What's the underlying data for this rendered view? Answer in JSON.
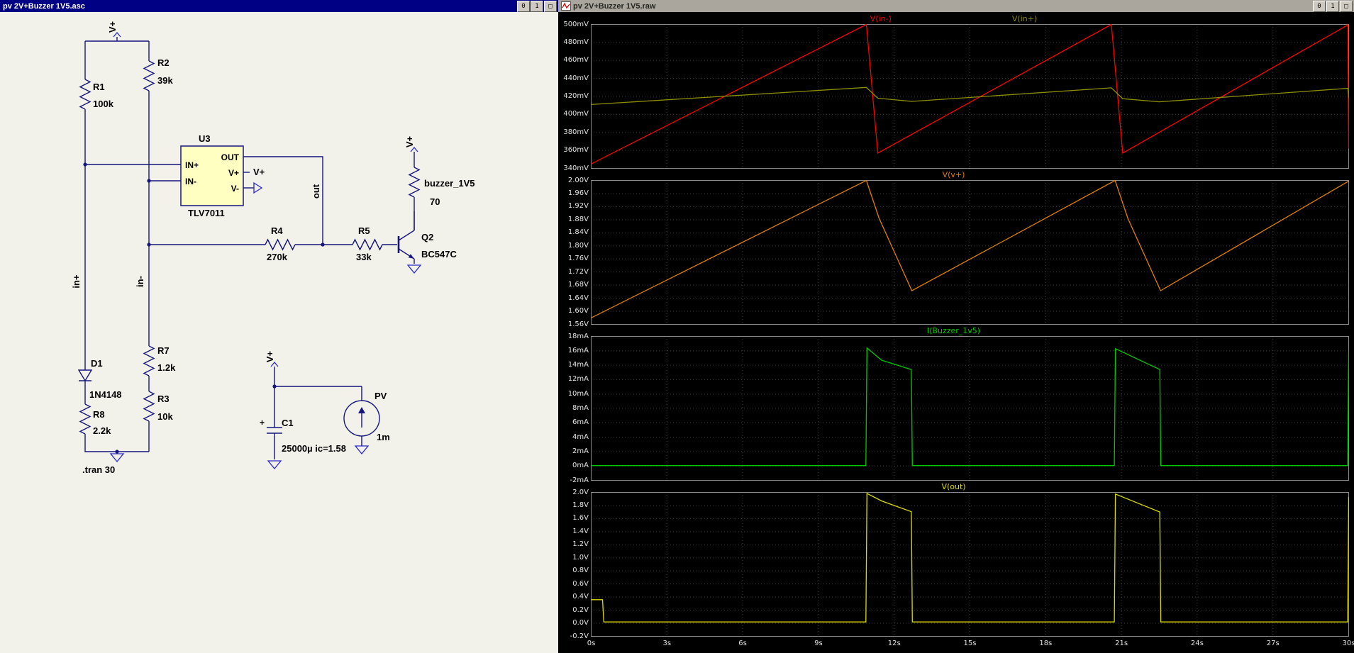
{
  "left_window": {
    "title": "pv 2V+Buzzer 1V5.asc",
    "window_buttons": [
      "0",
      "1",
      "□"
    ],
    "schematic": {
      "net_vplus": "V+",
      "net_in_plus": "in+",
      "net_in_minus": "in-",
      "net_out": "out",
      "r1": {
        "name": "R1",
        "value": "100k"
      },
      "r2": {
        "name": "R2",
        "value": "39k"
      },
      "r3": {
        "name": "R3",
        "value": "10k"
      },
      "r4": {
        "name": "R4",
        "value": "270k"
      },
      "r5": {
        "name": "R5",
        "value": "33k"
      },
      "r7": {
        "name": "R7",
        "value": "1.2k"
      },
      "r8": {
        "name": "R8",
        "value": "2.2k"
      },
      "buzzer": {
        "name": "buzzer_1V5",
        "value": "70"
      },
      "u3": {
        "name": "U3",
        "part": "TLV7011",
        "pin_in_plus": "IN+",
        "pin_in_minus": "IN-",
        "pin_out": "OUT",
        "pin_vplus": "V+",
        "pin_vminus": "V-"
      },
      "q2": {
        "name": "Q2",
        "part": "BC547C"
      },
      "d1": {
        "name": "D1",
        "part": "1N4148"
      },
      "c1": {
        "name": "C1",
        "value": "25000µ ic=1.58",
        "polarity": "+"
      },
      "pv": {
        "name": "PV",
        "value": "1m"
      },
      "directive": ".tran 30"
    }
  },
  "right_window": {
    "title": "pv 2V+Buzzer 1V5.raw",
    "window_buttons": [
      "0",
      "1",
      "□"
    ]
  },
  "time_axis": {
    "values": [
      0,
      3,
      6,
      9,
      12,
      15,
      18,
      21,
      24,
      27,
      30
    ],
    "labels": [
      "0s",
      "3s",
      "6s",
      "9s",
      "12s",
      "15s",
      "18s",
      "21s",
      "24s",
      "27s",
      "30s"
    ]
  },
  "chart_data": [
    {
      "type": "line",
      "xlim": [
        0,
        30
      ],
      "ylim": [
        0.34,
        0.5
      ],
      "titles": [
        {
          "text": "V(in-)",
          "color": "#ff0000"
        },
        {
          "text": "V(in+)",
          "color": "#8e8e00"
        }
      ],
      "ytick_values": [
        0.5,
        0.48,
        0.46,
        0.44,
        0.42,
        0.4,
        0.38,
        0.36,
        0.34
      ],
      "ytick_labels": [
        "500mV",
        "480mV",
        "460mV",
        "440mV",
        "420mV",
        "400mV",
        "380mV",
        "360mV",
        "340mV"
      ],
      "series": [
        {
          "name": "V(in-)",
          "color": "#ff0000",
          "points": [
            [
              0,
              0.345
            ],
            [
              10.9,
              0.5
            ],
            [
              11.35,
              0.357
            ],
            [
              20.6,
              0.5
            ],
            [
              21.05,
              0.357
            ],
            [
              29.97,
              0.4995
            ],
            [
              30,
              0.362
            ]
          ]
        },
        {
          "name": "V(in+)",
          "color": "#8e8e00",
          "points": [
            [
              0,
              0.411
            ],
            [
              10.9,
              0.43
            ],
            [
              11.35,
              0.418
            ],
            [
              12.7,
              0.4145
            ],
            [
              20.6,
              0.4295
            ],
            [
              21.05,
              0.4175
            ],
            [
              22.5,
              0.414
            ],
            [
              29.97,
              0.429
            ],
            [
              30,
              0.4185
            ]
          ]
        }
      ]
    },
    {
      "type": "line",
      "xlim": [
        0,
        30
      ],
      "ylim": [
        1.56,
        2.0
      ],
      "titles": [
        {
          "text": "V(v+)",
          "color": "#e08000"
        }
      ],
      "ytick_values": [
        2.0,
        1.96,
        1.92,
        1.88,
        1.84,
        1.8,
        1.76,
        1.72,
        1.68,
        1.64,
        1.6,
        1.56
      ],
      "ytick_labels": [
        "2.00V",
        "1.96V",
        "1.92V",
        "1.88V",
        "1.84V",
        "1.80V",
        "1.76V",
        "1.72V",
        "1.68V",
        "1.64V",
        "1.60V",
        "1.56V"
      ],
      "series": [
        {
          "name": "V(v+)",
          "color": "#e08000",
          "points": [
            [
              0,
              1.58
            ],
            [
              10.9,
              2.0
            ],
            [
              11.4,
              1.885
            ],
            [
              12.7,
              1.663
            ],
            [
              20.75,
              2.0
            ],
            [
              21.25,
              1.885
            ],
            [
              22.55,
              1.663
            ],
            [
              30,
              1.998
            ]
          ]
        }
      ]
    },
    {
      "type": "line",
      "xlim": [
        0,
        30
      ],
      "ylim": [
        -2,
        18
      ],
      "titles": [
        {
          "text": "I(Buzzer_1v5)",
          "color": "#00c800"
        }
      ],
      "ytick_values": [
        18,
        16,
        14,
        12,
        10,
        8,
        6,
        4,
        2,
        0,
        -2
      ],
      "ytick_labels": [
        "18mA",
        "16mA",
        "14mA",
        "12mA",
        "10mA",
        "8mA",
        "6mA",
        "4mA",
        "2mA",
        "0mA",
        "-2mA"
      ],
      "series": [
        {
          "name": "I(Buzzer_1v5)",
          "color": "#00c800",
          "points": [
            [
              0,
              0.05
            ],
            [
              10.88,
              0.05
            ],
            [
              10.92,
              16.4
            ],
            [
              11.5,
              14.7
            ],
            [
              12.68,
              13.4
            ],
            [
              12.72,
              0.05
            ],
            [
              20.72,
              0.05
            ],
            [
              20.76,
              16.3
            ],
            [
              22.52,
              13.4
            ],
            [
              22.56,
              0.05
            ],
            [
              29.96,
              0.05
            ],
            [
              30,
              15.8
            ]
          ]
        }
      ]
    },
    {
      "type": "line",
      "xlim": [
        0,
        30
      ],
      "ylim": [
        -0.2,
        2.0
      ],
      "titles": [
        {
          "text": "V(out)",
          "color": "#dcdc00"
        }
      ],
      "ytick_values": [
        2.0,
        1.8,
        1.6,
        1.4,
        1.2,
        1.0,
        0.8,
        0.6,
        0.4,
        0.2,
        0.0,
        -0.2
      ],
      "ytick_labels": [
        "2.0V",
        "1.8V",
        "1.6V",
        "1.4V",
        "1.2V",
        "1.0V",
        "0.8V",
        "0.6V",
        "0.4V",
        "0.2V",
        "0.0V",
        "-0.2V"
      ],
      "series": [
        {
          "name": "V(out)",
          "color": "#dcdc00",
          "points": [
            [
              0,
              0.36
            ],
            [
              0.45,
              0.36
            ],
            [
              0.5,
              0.02
            ],
            [
              10.88,
              0.02
            ],
            [
              10.92,
              1.985
            ],
            [
              11.5,
              1.87
            ],
            [
              12.68,
              1.705
            ],
            [
              12.72,
              0.02
            ],
            [
              20.72,
              0.02
            ],
            [
              20.76,
              1.975
            ],
            [
              22.52,
              1.7
            ],
            [
              22.56,
              0.02
            ],
            [
              29.96,
              0.02
            ],
            [
              30,
              1.93
            ]
          ]
        }
      ]
    }
  ]
}
